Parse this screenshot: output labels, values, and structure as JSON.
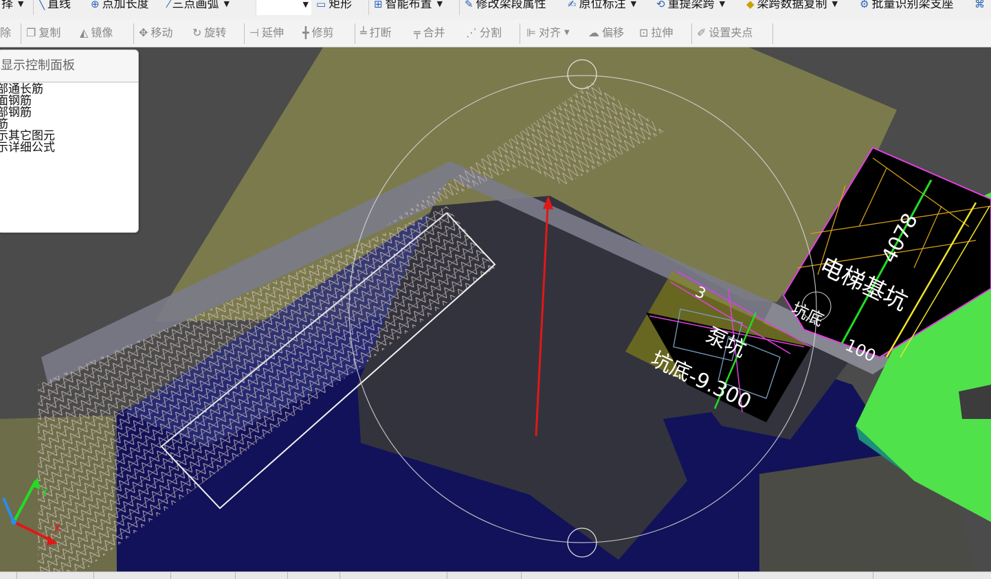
{
  "toolbar_top": {
    "select_label": "择",
    "line_label": "直线",
    "point_length_label": "点加长度",
    "arc_label": "三点画弧",
    "rect_label": "矩形",
    "smart_layout_label": "智能布置",
    "modify_span_label": "修改梁段属性",
    "inplace_label": "原位标注",
    "reextract_label": "重提梁跨",
    "span_copy_label": "梁跨数据复制",
    "batch_identify_label": "批量识别梁支座"
  },
  "toolbar_edit": {
    "delete_label": "除",
    "copy_label": "复制",
    "mirror_label": "镜像",
    "move_label": "移动",
    "rotate_label": "旋转",
    "extend_label": "延伸",
    "trim_label": "修剪",
    "break_label": "打断",
    "merge_label": "合并",
    "split_label": "分割",
    "align_label": "对齐",
    "offset_label": "偏移",
    "stretch_label": "拉伸",
    "grip_label": "设置夹点"
  },
  "panel": {
    "title": "显示控制面板",
    "items": [
      "部通长筋",
      "面钢筋",
      "部钢筋",
      "筋",
      "示其它图元",
      "示详细公式"
    ]
  },
  "viewport": {
    "label_pump_pit": "泵坑",
    "label_pit_bottom": "坑底-9.300",
    "label_elevator_pit": "电梯基坑",
    "label_dim": "4078",
    "label_pit_short": "坑底",
    "label_small_1": "3",
    "label_small_2": "100",
    "axis_y": "Y",
    "axis_x": "X"
  },
  "colors": {
    "slab": "#7d7b4c",
    "beam": "#7a7a8a",
    "deep": "#14145a",
    "green_block": "#4ee24a",
    "arrow": "#e01818",
    "magenta": "#e040e0",
    "gold": "#d4a017"
  }
}
